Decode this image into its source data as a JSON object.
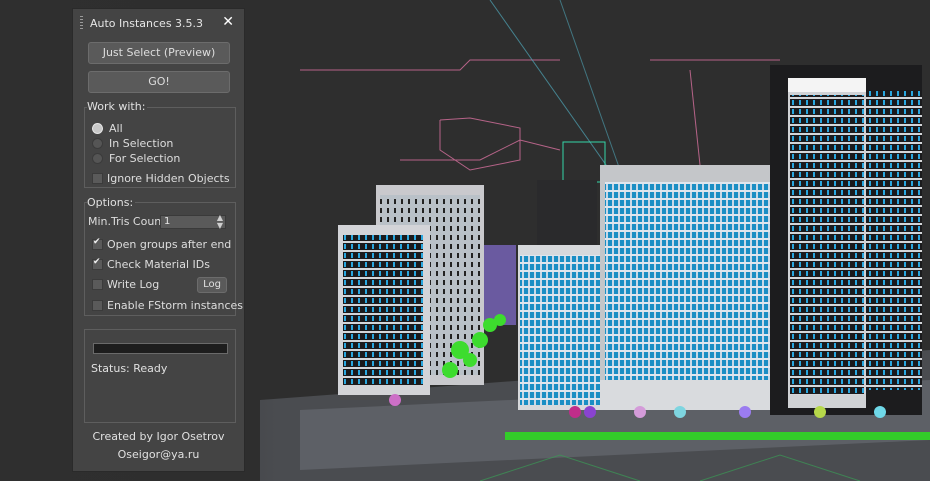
{
  "panel": {
    "title": "Auto Instances 3.5.3",
    "close_glyph": "✕",
    "buttons": {
      "select_preview": "Just Select (Preview)",
      "go": "GO!"
    },
    "work_with": {
      "label": "Work with:",
      "options": [
        {
          "label": "All",
          "selected": true
        },
        {
          "label": "In Selection",
          "selected": false
        },
        {
          "label": "For Selection",
          "selected": false
        }
      ],
      "ignore_hidden": {
        "label": "Ignore Hidden Objects",
        "checked": false
      }
    },
    "options": {
      "label": "Options:",
      "min_tris_label": "Min.Tris Count",
      "min_tris_value": "1",
      "open_groups": {
        "label": "Open groups after end",
        "checked": true
      },
      "check_material": {
        "label": "Check Material IDs",
        "checked": true
      },
      "write_log": {
        "label": "Write Log",
        "checked": false
      },
      "log_button": "Log",
      "fstorm": {
        "label": "Enable FStorm instances",
        "checked": false
      }
    },
    "progress": 0,
    "status": "Status: Ready",
    "credits": {
      "author": "Created by Igor Osetrov",
      "email": "Oseigor@ya.ru"
    }
  },
  "colors": {
    "panel_bg": "#444444",
    "viewport_bg": "#2f2f2f",
    "glass": "#1fa3d6",
    "trees": "#3ddc2e"
  }
}
